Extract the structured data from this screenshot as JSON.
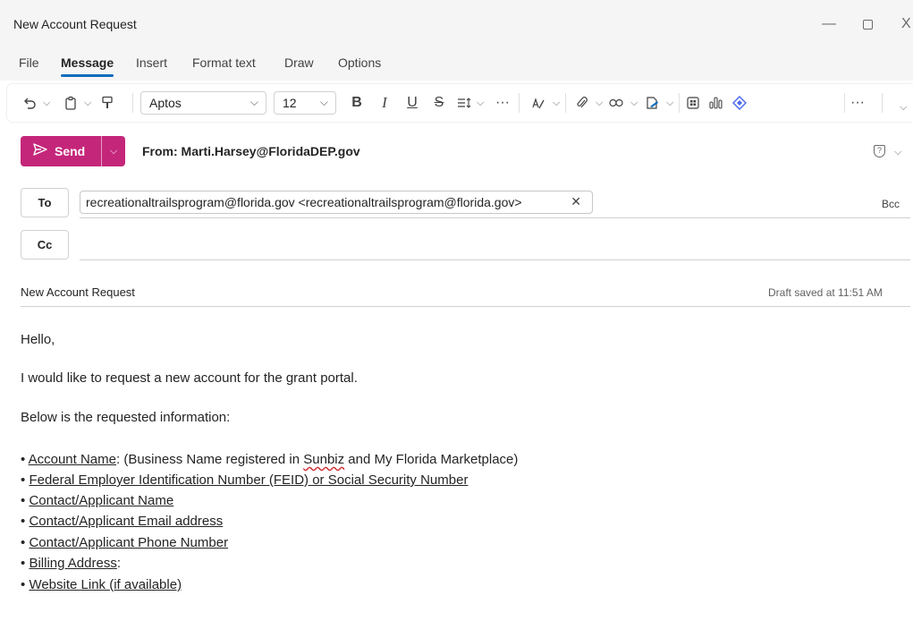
{
  "window": {
    "title": "New Account Request",
    "minimize": "—",
    "close": "X"
  },
  "menu": {
    "tabs": [
      "File",
      "Message",
      "Insert",
      "Format text",
      "Draw",
      "Options"
    ],
    "active": "Message"
  },
  "ribbon": {
    "font_name": "Aptos",
    "font_size": "12",
    "bold": "B",
    "italic": "I",
    "underline": "U",
    "strike": "S",
    "more": "···",
    "overflow": "···"
  },
  "compose": {
    "send_label": "Send",
    "from_label": "From: Marti.Harsey@FloridaDEP.gov",
    "to_label": "To",
    "cc_label": "Cc",
    "bcc_label": "Bcc",
    "recipients": [
      "recreationaltrailsprogram@florida.gov <recreationaltrailsprogram@florida.gov>"
    ],
    "subject": "New Account Request",
    "draft_status": "Draft saved at 11:51 AM",
    "send_color": "#c4267a",
    "accent_color": "#0f6cbd"
  },
  "body": {
    "greeting": "Hello,",
    "para1": "I would like to request a new account for the grant portal.",
    "para2": "Below is the requested information:",
    "bullet": "•",
    "items": [
      {
        "label": "Account Name",
        "pre_rest": ": (Business Name registered in ",
        "misspelled": "Sunbiz",
        "post_rest": " and My Florida Marketplace)"
      },
      {
        "label": "Federal Employer Identification Number (FEID) or Social Security Number"
      },
      {
        "label": "Contact/Applicant Name"
      },
      {
        "label": "Contact/Applicant Email address"
      },
      {
        "label": "Contact/Applicant Phone Number"
      },
      {
        "label": "Billing Address",
        "rest": ":"
      },
      {
        "label": "Website Link (if available)"
      }
    ]
  }
}
